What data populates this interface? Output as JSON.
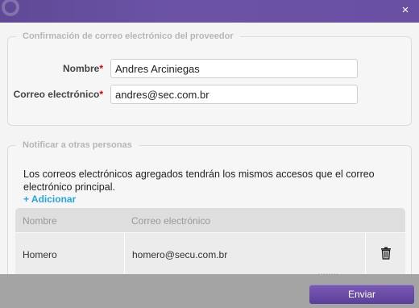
{
  "dialog": {
    "close_glyph": "×",
    "accent": "#6b52a5"
  },
  "provider_section": {
    "legend": "Confirmación de correo electrónico del proveedor",
    "name_label": "Nombre",
    "name_value": "Andres Arciniegas",
    "email_label": "Correo electrónico",
    "email_value": "andres@sec.com.br",
    "required_mark": "*"
  },
  "notify_section": {
    "legend": "Notificar a otras personas",
    "notice": "Los correos electrónicos agregados tendrán los mismos accesos que el correo electrónico principal.",
    "add_label": "+ Adicionar",
    "table": {
      "headers": [
        "Nombre",
        "Correo electrónico"
      ],
      "rows": [
        {
          "name": "Homero",
          "email": "homero@secu.com.br",
          "action_icon": "trash-icon"
        }
      ]
    }
  },
  "footer": {
    "send_label": "Enviar"
  }
}
